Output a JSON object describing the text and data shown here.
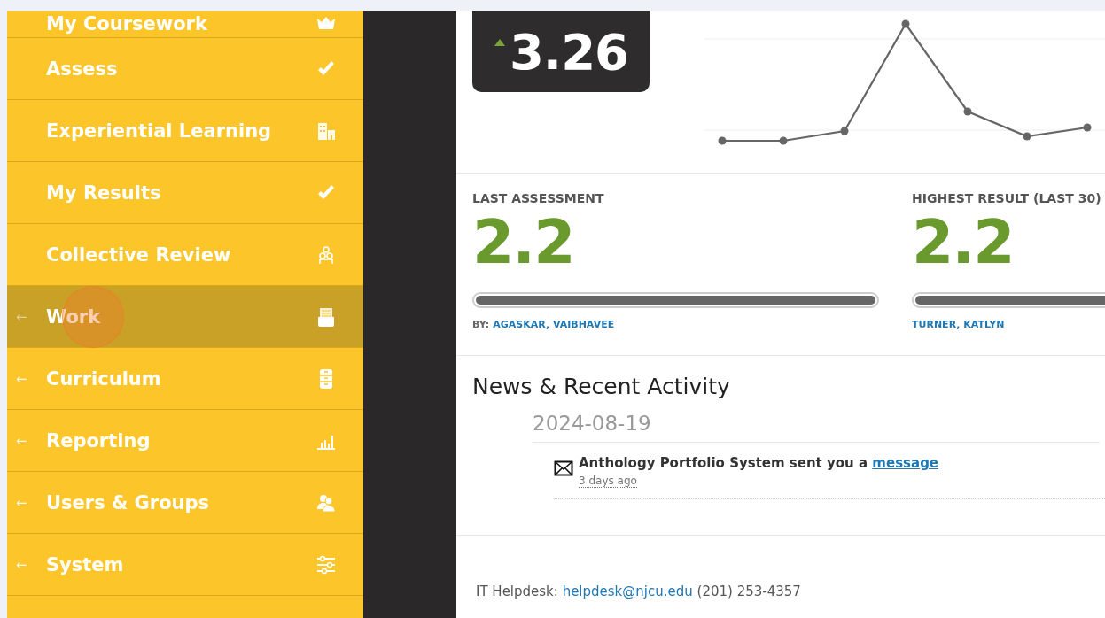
{
  "sidebar": {
    "items": [
      {
        "label": "My Coursework",
        "selected": false
      },
      {
        "label": "Assess",
        "selected": false
      },
      {
        "label": "Experiential Learning",
        "selected": false
      },
      {
        "label": "My Results",
        "selected": false
      },
      {
        "label": "Collective Review",
        "selected": false
      },
      {
        "label": "Work",
        "arrow": "←",
        "selected": true
      },
      {
        "label": "Curriculum",
        "arrow": "←",
        "selected": false
      },
      {
        "label": "Reporting",
        "arrow": "←",
        "selected": false
      },
      {
        "label": "Users & Groups",
        "arrow": "←",
        "selected": false
      },
      {
        "label": "System",
        "arrow": "←",
        "selected": false
      }
    ]
  },
  "score": {
    "value": "3.26"
  },
  "stats": [
    {
      "label": "LAST ASSESSMENT",
      "value": "2.2",
      "level": 1,
      "by_prefix": "BY:",
      "name": "AGASKAR, VAIBHAVEE"
    },
    {
      "label": "HIGHEST RESULT (LAST 30)",
      "value": "2.2",
      "level": 1,
      "name": "TURNER, KATLYN"
    }
  ],
  "news": {
    "title": "News & Recent Activity",
    "date": "2024-08-19",
    "items": [
      {
        "text": "Anthology Portfolio System sent you a",
        "link": "message",
        "time": "3 days ago"
      }
    ]
  },
  "footer": {
    "label": "IT Helpdesk:",
    "email": "helpdesk@njcu.edu",
    "phone": "(201) 253-4357"
  }
}
